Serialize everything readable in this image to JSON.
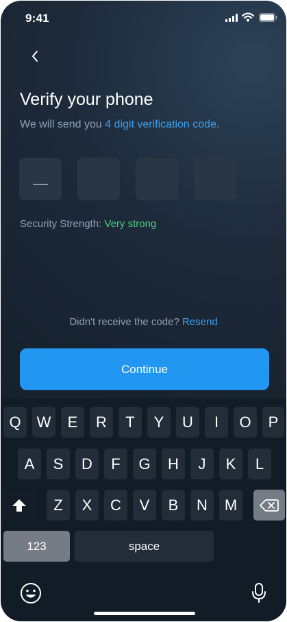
{
  "status_bar": {
    "time": "9:41"
  },
  "header": {
    "back_icon": "chevron-left-icon"
  },
  "verify": {
    "title": "Verify your phone",
    "subtitle_prefix": "We will send you ",
    "subtitle_highlight": "4 digit verification code",
    "subtitle_suffix": ".",
    "otp_boxes": [
      "",
      "",
      "",
      ""
    ],
    "strength_label": "Security Strength: ",
    "strength_value": "Very strong"
  },
  "resend": {
    "text": "Didn't receive the code? ",
    "link": "Resend"
  },
  "continue_label": "Continue",
  "keyboard": {
    "row1": [
      "Q",
      "W",
      "E",
      "R",
      "T",
      "Y",
      "U",
      "I",
      "O",
      "P"
    ],
    "row2": [
      "A",
      "S",
      "D",
      "F",
      "G",
      "H",
      "J",
      "K",
      "L"
    ],
    "row3": [
      "Z",
      "X",
      "C",
      "V",
      "B",
      "N",
      "M"
    ],
    "numbers_label": "123",
    "space_label": "space",
    "icons": {
      "shift": "shift-icon",
      "backspace": "backspace-icon",
      "emoji": "emoji-icon",
      "mic": "microphone-icon"
    }
  },
  "colors": {
    "accent": "#2197f1",
    "link": "#3aa0f0",
    "success": "#4cd07a",
    "background": "#18222f",
    "keyboard": "#121c27"
  }
}
